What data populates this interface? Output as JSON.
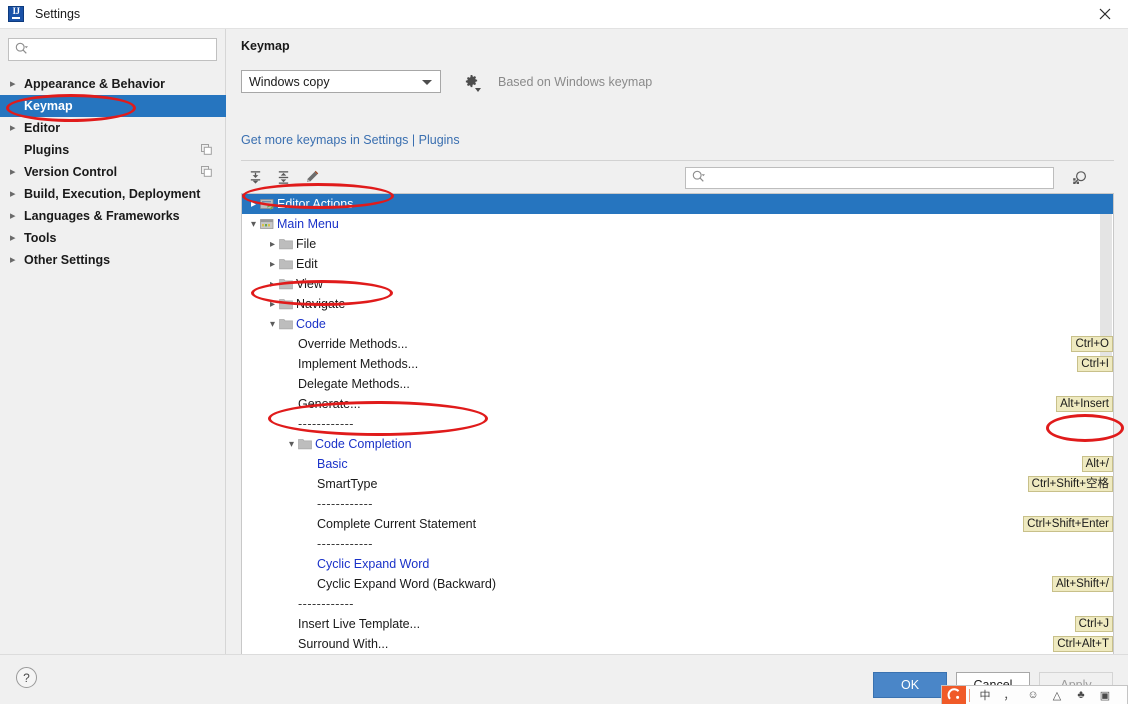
{
  "window": {
    "title": "Settings",
    "logo_icon": "intellij-idea-logo",
    "close_icon": "close-icon"
  },
  "sidebar": {
    "search": {
      "placeholder": "",
      "value": "",
      "icon": "search-icon"
    },
    "items": [
      {
        "label": "Appearance & Behavior",
        "expandable": true,
        "selected": false,
        "badge": false
      },
      {
        "label": "Keymap",
        "expandable": false,
        "selected": true,
        "badge": false
      },
      {
        "label": "Editor",
        "expandable": true,
        "selected": false,
        "badge": false
      },
      {
        "label": "Plugins",
        "expandable": false,
        "selected": false,
        "badge": true
      },
      {
        "label": "Version Control",
        "expandable": true,
        "selected": false,
        "badge": true
      },
      {
        "label": "Build, Execution, Deployment",
        "expandable": true,
        "selected": false,
        "badge": false
      },
      {
        "label": "Languages & Frameworks",
        "expandable": true,
        "selected": false,
        "badge": false
      },
      {
        "label": "Tools",
        "expandable": true,
        "selected": false,
        "badge": false
      },
      {
        "label": "Other Settings",
        "expandable": true,
        "selected": false,
        "badge": false
      }
    ]
  },
  "main": {
    "page_title": "Keymap",
    "keymap_select": {
      "value": "Windows copy",
      "arrow_icon": "chevron-down-icon"
    },
    "gear_icon": "gear-icon",
    "based_on": "Based on Windows keymap",
    "link": "Get more keymaps in Settings | Plugins",
    "toolbar": {
      "expand_all_icon": "expand-all-icon",
      "collapse_all_icon": "collapse-all-icon",
      "edit_shortcut_icon": "pencil-edit-icon",
      "search": {
        "placeholder": "",
        "value": "",
        "icon": "search-icon"
      },
      "find_by_shortcut_icon": "find-by-shortcut-icon"
    }
  },
  "tree": [
    {
      "label": "Editor Actions",
      "indent": 0,
      "chevron": "right",
      "icon": "editor-actions-icon",
      "selected": true,
      "color": "default",
      "shortcut": ""
    },
    {
      "label": "Main Menu",
      "indent": 0,
      "chevron": "down",
      "icon": "main-menu-icon",
      "selected": false,
      "color": "blue",
      "shortcut": ""
    },
    {
      "label": "File",
      "indent": 1,
      "chevron": "right",
      "icon": "folder-icon",
      "selected": false,
      "color": "default",
      "shortcut": ""
    },
    {
      "label": "Edit",
      "indent": 1,
      "chevron": "right",
      "icon": "folder-icon",
      "selected": false,
      "color": "default",
      "shortcut": ""
    },
    {
      "label": "View",
      "indent": 1,
      "chevron": "right",
      "icon": "folder-icon",
      "selected": false,
      "color": "default",
      "shortcut": ""
    },
    {
      "label": "Navigate",
      "indent": 1,
      "chevron": "right",
      "icon": "folder-icon",
      "selected": false,
      "color": "default",
      "shortcut": ""
    },
    {
      "label": "Code",
      "indent": 1,
      "chevron": "down",
      "icon": "folder-icon",
      "selected": false,
      "color": "blue",
      "shortcut": ""
    },
    {
      "label": "Override Methods...",
      "indent": 2,
      "chevron": "none",
      "icon": "none",
      "selected": false,
      "color": "default",
      "shortcut": "Ctrl+O"
    },
    {
      "label": "Implement Methods...",
      "indent": 2,
      "chevron": "none",
      "icon": "none",
      "selected": false,
      "color": "default",
      "shortcut": "Ctrl+I"
    },
    {
      "label": "Delegate Methods...",
      "indent": 2,
      "chevron": "none",
      "icon": "none",
      "selected": false,
      "color": "default",
      "shortcut": ""
    },
    {
      "label": "Generate...",
      "indent": 2,
      "chevron": "none",
      "icon": "none",
      "selected": false,
      "color": "default",
      "shortcut": "Alt+Insert"
    },
    {
      "label": "------------",
      "indent": 2,
      "chevron": "none",
      "icon": "none",
      "selected": false,
      "color": "separator",
      "shortcut": ""
    },
    {
      "label": "Code Completion",
      "indent": 2,
      "chevron": "down",
      "icon": "folder-icon",
      "selected": false,
      "color": "blue",
      "shortcut": ""
    },
    {
      "label": "Basic",
      "indent": 3,
      "chevron": "none",
      "icon": "none",
      "selected": false,
      "color": "blue",
      "shortcut": "Alt+/"
    },
    {
      "label": "SmartType",
      "indent": 3,
      "chevron": "none",
      "icon": "none",
      "selected": false,
      "color": "default",
      "shortcut": "Ctrl+Shift+空格"
    },
    {
      "label": "------------",
      "indent": 3,
      "chevron": "none",
      "icon": "none",
      "selected": false,
      "color": "separator",
      "shortcut": ""
    },
    {
      "label": "Complete Current Statement",
      "indent": 3,
      "chevron": "none",
      "icon": "none",
      "selected": false,
      "color": "default",
      "shortcut": "Ctrl+Shift+Enter"
    },
    {
      "label": "------------",
      "indent": 3,
      "chevron": "none",
      "icon": "none",
      "selected": false,
      "color": "separator",
      "shortcut": ""
    },
    {
      "label": "Cyclic Expand Word",
      "indent": 3,
      "chevron": "none",
      "icon": "none",
      "selected": false,
      "color": "blue",
      "shortcut": ""
    },
    {
      "label": "Cyclic Expand Word (Backward)",
      "indent": 3,
      "chevron": "none",
      "icon": "none",
      "selected": false,
      "color": "default",
      "shortcut": "Alt+Shift+/"
    },
    {
      "label": "------------",
      "indent": 2,
      "chevron": "none",
      "icon": "none",
      "selected": false,
      "color": "separator",
      "shortcut": ""
    },
    {
      "label": "Insert Live Template...",
      "indent": 2,
      "chevron": "none",
      "icon": "none",
      "selected": false,
      "color": "default",
      "shortcut": "Ctrl+J"
    },
    {
      "label": "Surround With...",
      "indent": 2,
      "chevron": "none",
      "icon": "none",
      "selected": false,
      "color": "default",
      "shortcut": "Ctrl+Alt+T"
    }
  ],
  "footer": {
    "help_label": "?",
    "ok_label": "OK",
    "cancel_label": "Cancel",
    "apply_label": "Apply"
  },
  "ime_bar": {
    "logo_icon": "sogou-ime-logo",
    "items": [
      {
        "icon": "chinese-english-toggle-icon",
        "glyph": "中"
      },
      {
        "icon": "punctuation-mode-icon",
        "glyph": "，"
      },
      {
        "icon": "emoji-icon",
        "glyph": "☺"
      },
      {
        "icon": "toolbox-icon",
        "glyph": "△"
      },
      {
        "icon": "voice-input-icon",
        "glyph": "♣"
      },
      {
        "icon": "panel-icon",
        "glyph": "▣"
      }
    ]
  },
  "annotations": [
    {
      "name": "highlight-keymap"
    },
    {
      "name": "highlight-main-menu"
    },
    {
      "name": "highlight-code"
    },
    {
      "name": "highlight-code-completion-basic"
    },
    {
      "name": "highlight-alt-slash-shortcut"
    }
  ],
  "colors": {
    "selection_blue": "#2675bf",
    "link_blue": "#3a6fb0",
    "tree_blue": "#1a32c8",
    "shortcut_bg": "#efeac0",
    "annotation_red": "#e01b1b",
    "ok_button": "#4a86c8"
  }
}
